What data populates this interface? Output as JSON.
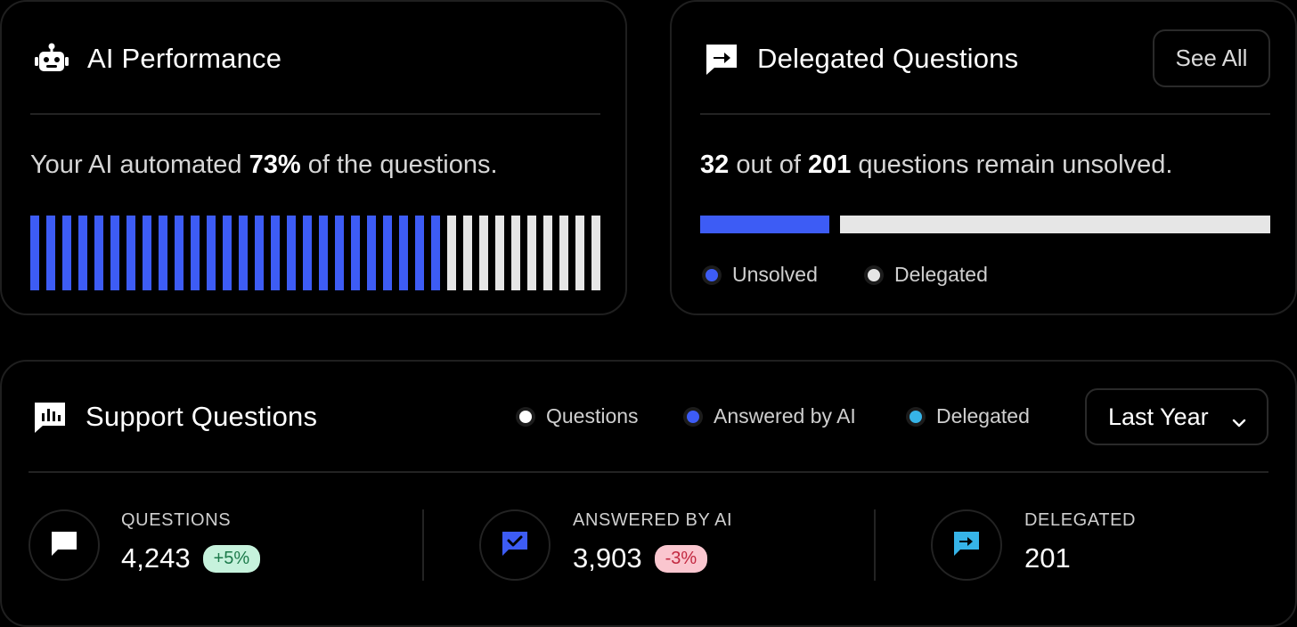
{
  "ai_performance": {
    "title": "AI Performance",
    "icon": "robot-icon",
    "sentence_pre": "Your AI automated ",
    "percent": "73%",
    "sentence_post": " of the questions.",
    "automated_fraction": 0.73,
    "bar_count": 36,
    "colors": {
      "filled": "#3d5cf5",
      "empty": "#e6e6e6"
    }
  },
  "delegated": {
    "title": "Delegated Questions",
    "icon": "forward-message-icon",
    "see_all_label": "See All",
    "unsolved_count": "32",
    "total_count": "201",
    "mid_text": " out of ",
    "end_text": " questions remain unsolved.",
    "unsolved_fraction": 0.226,
    "legend": [
      {
        "label": "Unsolved",
        "color": "#3d5cf5"
      },
      {
        "label": "Delegated",
        "color": "#e6e6e6"
      }
    ]
  },
  "support": {
    "title": "Support Questions",
    "icon": "bar-chart-icon",
    "legend": [
      {
        "label": "Questions",
        "color": "#ffffff"
      },
      {
        "label": "Answered by AI",
        "color": "#3d5cf5"
      },
      {
        "label": "Delegated",
        "color": "#36b4e8"
      }
    ],
    "period": "Last Year",
    "stats": [
      {
        "label": "QUESTIONS",
        "value": "4,243",
        "badge": "+5%",
        "badge_type": "positive",
        "icon": "chat-bubble-icon"
      },
      {
        "label": "ANSWERED BY AI",
        "value": "3,903",
        "badge": "-3%",
        "badge_type": "negative",
        "icon": "chat-check-icon"
      },
      {
        "label": "DELEGATED",
        "value": "201",
        "badge": "",
        "badge_type": "none",
        "icon": "forward-icon"
      }
    ]
  }
}
